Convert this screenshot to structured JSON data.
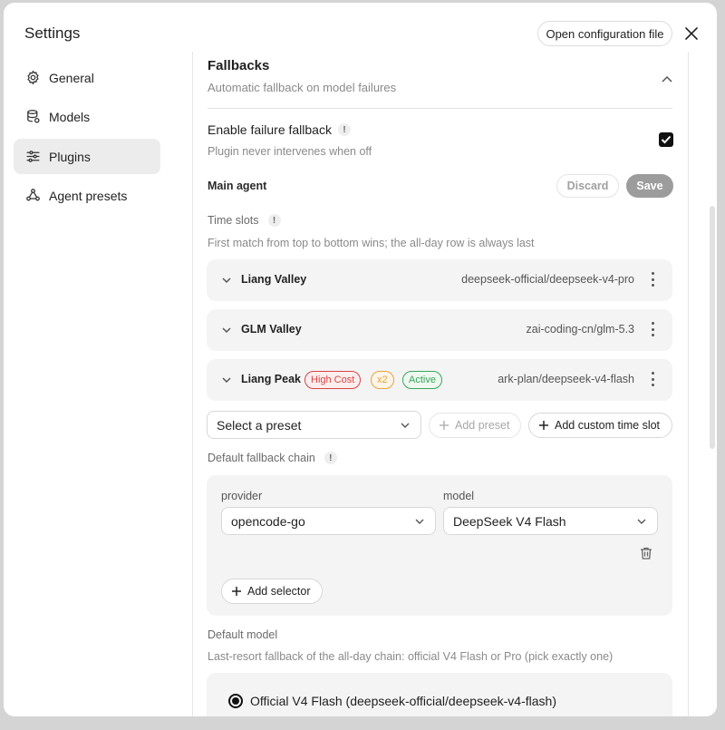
{
  "window": {
    "title": "Settings",
    "open_config_label": "Open configuration file"
  },
  "sidebar": {
    "items": [
      {
        "label": "General",
        "icon": "gear-icon",
        "active": false
      },
      {
        "label": "Models",
        "icon": "database-icon",
        "active": false
      },
      {
        "label": "Plugins",
        "icon": "sliders-icon",
        "active": true
      },
      {
        "label": "Agent presets",
        "icon": "agent-icon",
        "active": false
      }
    ]
  },
  "fallbacks": {
    "title": "Fallbacks",
    "subtitle": "Automatic fallback on model failures",
    "enable_label": "Enable failure fallback",
    "enable_hint": "Plugin never intervenes when off",
    "enabled": true,
    "info_glyph": "!"
  },
  "main_agent": {
    "label": "Main agent",
    "discard_label": "Discard",
    "save_label": "Save"
  },
  "time_slots": {
    "label": "Time slots",
    "hint": "First match from top to bottom wins; the all-day row is always last",
    "slots": [
      {
        "name": "Liang Valley",
        "model": "deepseek-official/deepseek-v4-pro",
        "tags": []
      },
      {
        "name": "GLM Valley",
        "model": "zai-coding-cn/glm-5.3",
        "tags": []
      },
      {
        "name": "Liang Peak",
        "model": "ark-plan/deepseek-v4-flash",
        "tags": [
          "High Cost",
          "x2",
          "Active"
        ]
      }
    ],
    "preset_placeholder": "Select a preset",
    "add_preset_label": "Add preset",
    "add_custom_label": "Add custom time slot"
  },
  "fallback_chain": {
    "label": "Default fallback chain",
    "provider_label": "provider",
    "model_label": "model",
    "provider_value": "opencode-go",
    "model_value": "DeepSeek V4 Flash",
    "add_selector_label": "Add selector"
  },
  "default_model": {
    "label": "Default model",
    "hint": "Last-resort fallback of the all-day chain: official V4 Flash or Pro (pick exactly one)",
    "option_label": "Official V4 Flash (deepseek-official/deepseek-v4-flash)",
    "selected": true
  },
  "colors": {
    "high_cost": "#d64545",
    "x2": "#e8a33c",
    "active": "#3aa55d",
    "save_bg": "#9c9c9c"
  }
}
